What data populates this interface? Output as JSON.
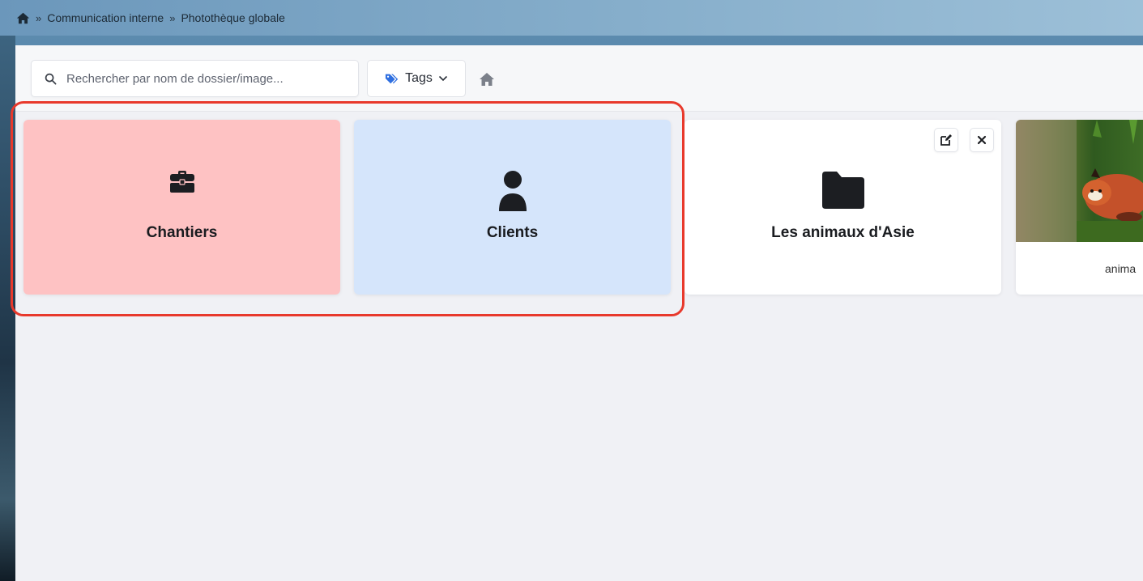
{
  "breadcrumb": {
    "items": [
      "Communication interne",
      "Photothèque globale"
    ],
    "separator": "»"
  },
  "toolbar": {
    "search_placeholder": "Rechercher par nom de dossier/image...",
    "tags_label": "Tags"
  },
  "cards": [
    {
      "label": "Chantiers",
      "icon": "briefcase-icon",
      "color": "#fec2c3"
    },
    {
      "label": "Clients",
      "icon": "user-icon",
      "color": "#d5e5fb"
    },
    {
      "label": "Les animaux d'Asie",
      "icon": "folder-icon",
      "color": "#ffffff"
    }
  ],
  "image_card": {
    "caption": "anima"
  },
  "colors": {
    "highlight": "#e8392c",
    "tag_icon": "#2f6fe0"
  }
}
